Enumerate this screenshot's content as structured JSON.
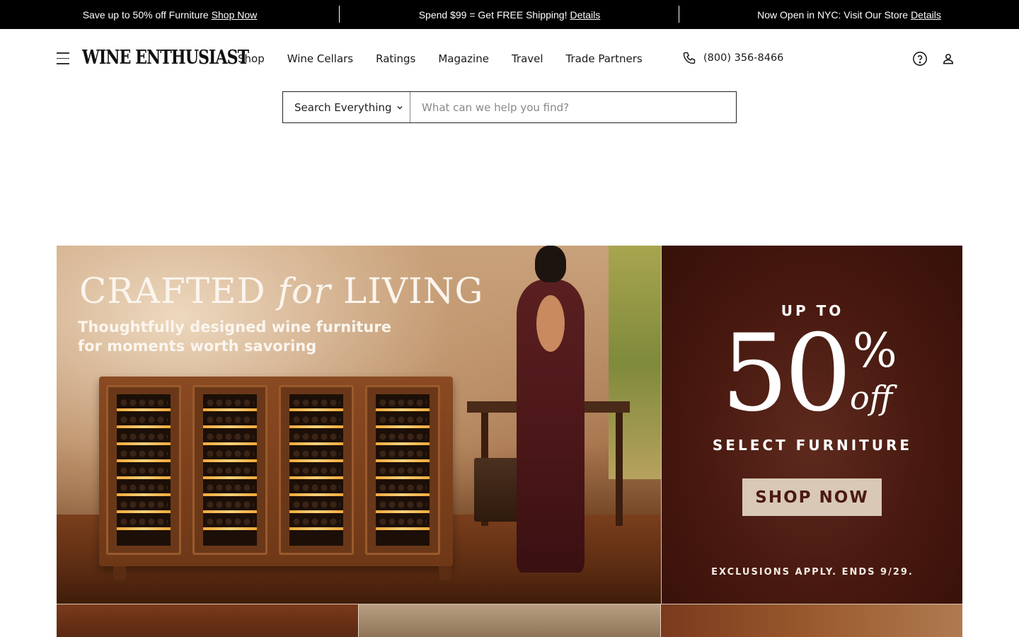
{
  "announcements": [
    {
      "text": "Save up to 50% off Furniture",
      "link": "Shop Now"
    },
    {
      "text": "Spend $99 = Get FREE Shipping!",
      "link": "Details"
    },
    {
      "text": "Now Open in NYC: Visit Our Store",
      "link": "Details"
    }
  ],
  "header": {
    "logo": "WINE ENTHUSIAST",
    "nav": [
      "Shop",
      "Wine Cellars",
      "Ratings",
      "Magazine",
      "Travel",
      "Trade Partners"
    ],
    "phone": "(800) 356-8466",
    "icons": [
      "menu-icon",
      "phone-icon",
      "help-icon",
      "account-icon"
    ]
  },
  "search": {
    "scope": "Search Everything",
    "placeholder": "What can we help you find?"
  },
  "hero": {
    "title_a": "CRAFTED ",
    "title_b": "for",
    "title_c": " LIVING",
    "subtitle_line1": "Thoughtfully designed wine furniture",
    "subtitle_line2": "for moments worth savoring",
    "promo": {
      "up_to": "UP TO",
      "number": "50",
      "percent": "%",
      "off": "off",
      "select": "SELECT FURNITURE",
      "cta": "SHOP NOW",
      "exclusions": "EXCLUSIONS APPLY. ENDS 9/29."
    }
  },
  "colors": {
    "announce_bg": "#000000",
    "promo_bg": "#47180f",
    "cta_bg": "#d9c8b6"
  }
}
